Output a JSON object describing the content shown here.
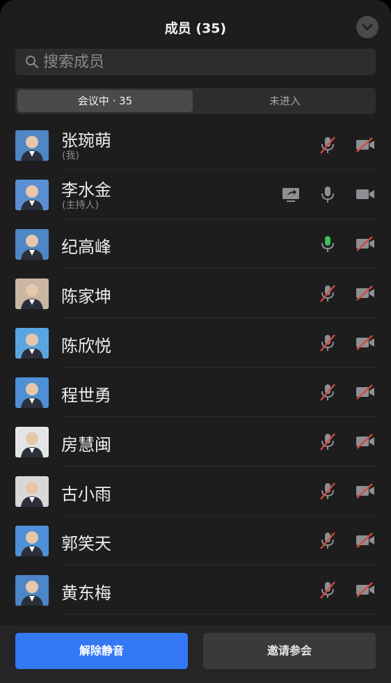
{
  "header": {
    "title": "成员 (35)"
  },
  "search": {
    "placeholder": "搜索成员"
  },
  "tabs": [
    {
      "label": "会议中 · 35",
      "active": true
    },
    {
      "label": "未进入",
      "active": false
    }
  ],
  "members": [
    {
      "name": "张琬萌",
      "role": "(我)",
      "mic": "muted",
      "camera": "off",
      "sharing": false,
      "avatar_bg": "#4e86c4"
    },
    {
      "name": "李水金",
      "role": "(主持人)",
      "mic": "on",
      "camera": "on",
      "sharing": true,
      "avatar_bg": "#5a8fd1"
    },
    {
      "name": "纪高峰",
      "role": "",
      "mic": "speaking",
      "camera": "off",
      "sharing": false,
      "avatar_bg": "#4f86c6"
    },
    {
      "name": "陈家坤",
      "role": "",
      "mic": "muted",
      "camera": "off",
      "sharing": false,
      "avatar_bg": "#c9b6a3"
    },
    {
      "name": "陈欣悦",
      "role": "",
      "mic": "muted",
      "camera": "off",
      "sharing": false,
      "avatar_bg": "#5aa6e3"
    },
    {
      "name": "程世勇",
      "role": "",
      "mic": "muted",
      "camera": "off",
      "sharing": false,
      "avatar_bg": "#4f8fd6"
    },
    {
      "name": "房慧闽",
      "role": "",
      "mic": "muted",
      "camera": "off",
      "sharing": false,
      "avatar_bg": "#e4e4e4"
    },
    {
      "name": "古小雨",
      "role": "",
      "mic": "muted",
      "camera": "off",
      "sharing": false,
      "avatar_bg": "#d8d8d8"
    },
    {
      "name": "郭笑天",
      "role": "",
      "mic": "muted",
      "camera": "off",
      "sharing": false,
      "avatar_bg": "#4f90d8"
    },
    {
      "name": "黄东梅",
      "role": "",
      "mic": "muted",
      "camera": "off",
      "sharing": false,
      "avatar_bg": "#4c86c7"
    }
  ],
  "footer": {
    "unmute_label": "解除静音",
    "invite_label": "邀请参会"
  },
  "colors": {
    "accent": "#3478f6",
    "muted_red": "#d24b3f",
    "speaking_green": "#3fbf5a",
    "icon_gray": "#8e8e93"
  }
}
